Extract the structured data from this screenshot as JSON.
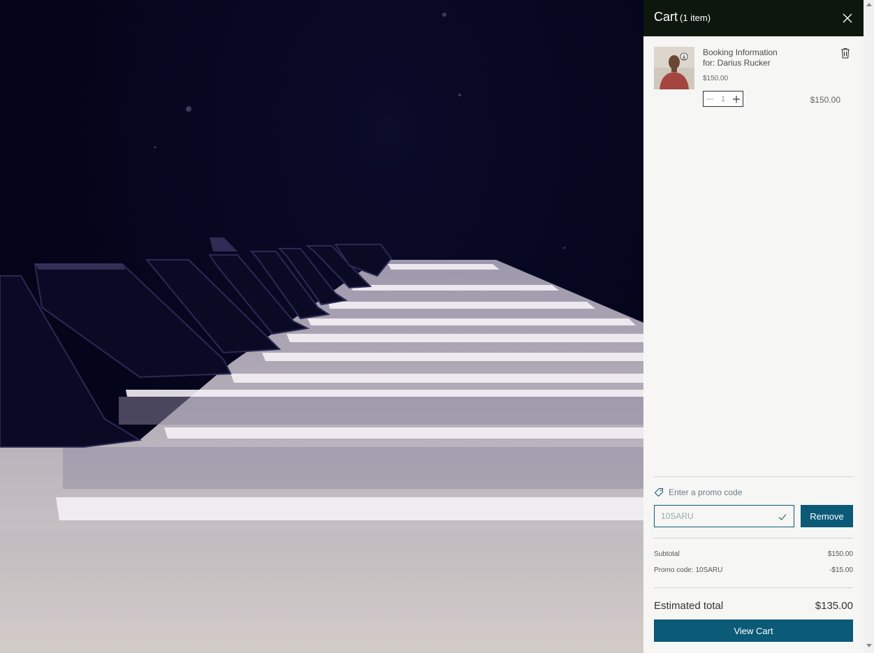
{
  "cart": {
    "title": "Cart",
    "count_label": "(1 item)",
    "item": {
      "name_line1": "Booking Information",
      "name_line2": "for: Darius Rucker",
      "unit_price": "$150.00",
      "quantity": "1",
      "total": "$150.00"
    },
    "promo": {
      "link_label": "Enter a promo code",
      "input_value": "10SARU",
      "remove_label": "Remove"
    },
    "summary": {
      "subtotal_label": "Subtotal",
      "subtotal_value": "$150.00",
      "promo_label": "Promo code: 10SARU",
      "promo_value": "-$15.00",
      "estimated_label": "Estimated total",
      "estimated_value": "$135.00"
    },
    "view_cart_label": "View Cart"
  },
  "colors": {
    "header_bg": "#0e170d",
    "accent": "#0b5a77",
    "panel_bg": "#f6f7f4"
  },
  "icons": [
    "close-icon",
    "trash-icon",
    "minus-icon",
    "plus-icon",
    "tag-icon",
    "check-icon"
  ]
}
